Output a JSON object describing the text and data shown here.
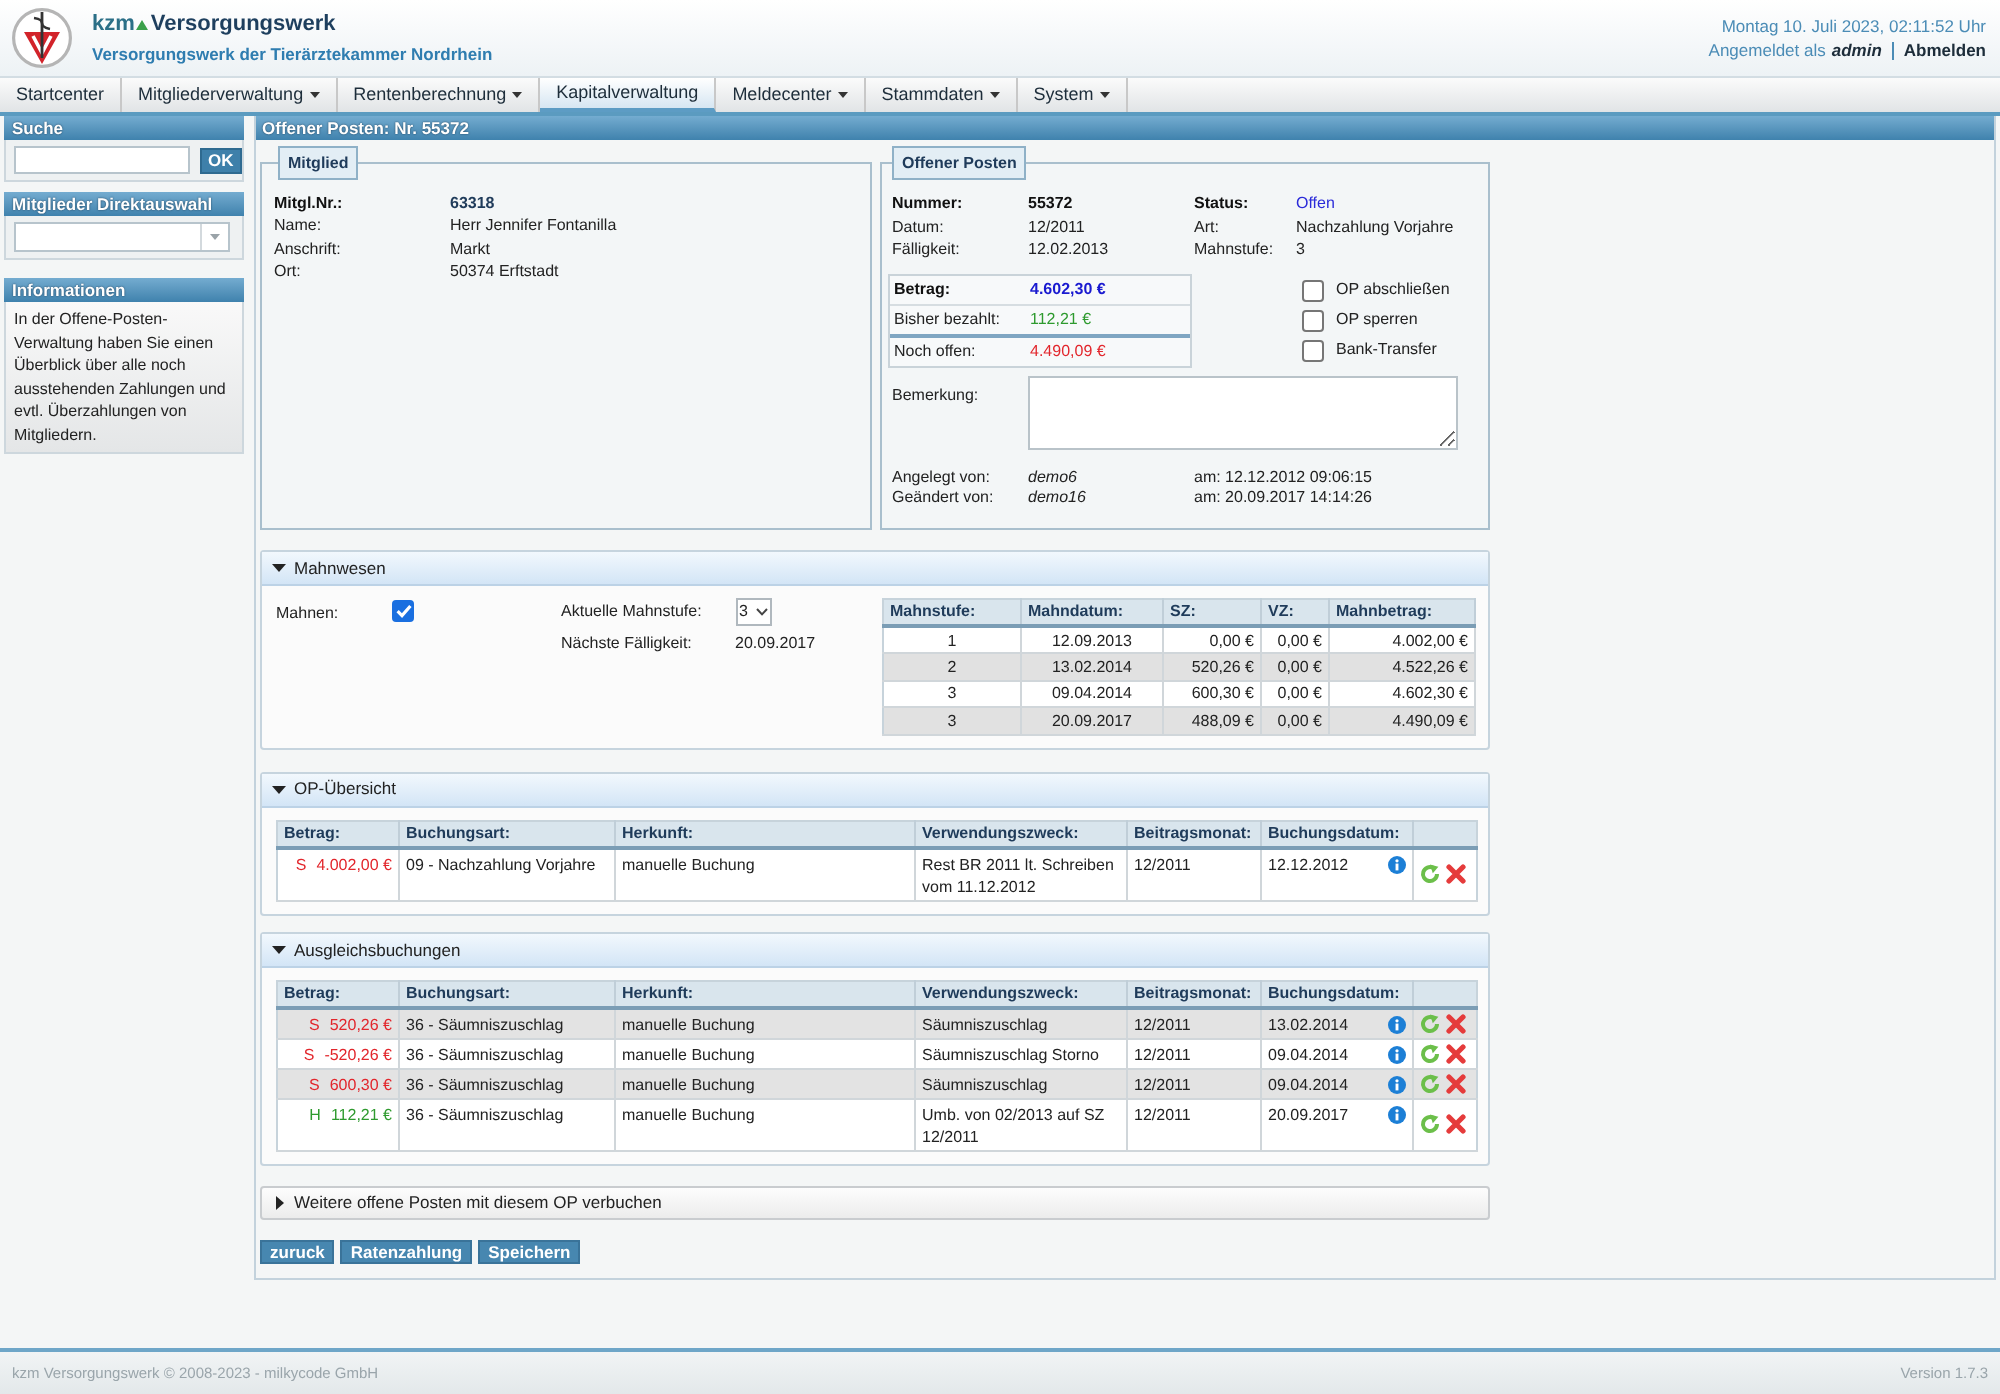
{
  "header": {
    "brand": "kzm",
    "title": "Versorgungswerk",
    "subtitle": "Versorgungswerk der Tierärztekammer Nordrhein",
    "datetime": "Montag 10. Juli 2023, 02:11:52 Uhr",
    "login_prefix": "Angemeldet als",
    "user": "admin",
    "logout": "Abmelden"
  },
  "nav": [
    {
      "label": "Startcenter",
      "has_menu": false,
      "selected": false
    },
    {
      "label": "Mitgliederverwaltung",
      "has_menu": true,
      "selected": false
    },
    {
      "label": "Rentenberechnung",
      "has_menu": true,
      "selected": false
    },
    {
      "label": "Kapitalverwaltung",
      "has_menu": false,
      "selected": true
    },
    {
      "label": "Meldecenter",
      "has_menu": true,
      "selected": false
    },
    {
      "label": "Stammdaten",
      "has_menu": true,
      "selected": false
    },
    {
      "label": "System",
      "has_menu": true,
      "selected": false
    }
  ],
  "sidebar": {
    "search": {
      "title": "Suche",
      "button": "OK"
    },
    "direct_select": {
      "title": "Mitglieder Direktauswahl"
    },
    "info": {
      "title": "Informationen",
      "text": "In der Offene-Posten-Verwaltung haben Sie einen Überblick über alle noch ausstehenden Zahlungen und evtl. Überzahlungen von Mitgliedern."
    }
  },
  "panel": {
    "title": "Offener Posten: Nr. 55372",
    "member": {
      "legend": "Mitglied",
      "fields": [
        {
          "label": "Mitgl.Nr.:",
          "value": "63318",
          "bold": true
        },
        {
          "label": "Name:",
          "value": "Herr Jennifer Fontanilla",
          "bold": false
        },
        {
          "label": "Anschrift:",
          "value": "Markt",
          "bold": false
        },
        {
          "label": "Ort:",
          "value": "50374 Erftstadt",
          "bold": false
        }
      ]
    },
    "open_item": {
      "legend": "Offener Posten",
      "left_fields": [
        {
          "label": "Nummer:",
          "value": "55372",
          "bold": true
        },
        {
          "label": "Datum:",
          "value": "12/2011",
          "bold": false
        },
        {
          "label": "Fälligkeit:",
          "value": "12.02.2013",
          "bold": false
        }
      ],
      "right_fields": [
        {
          "label": "Status:",
          "value": "Offen",
          "bold": true,
          "color": "#2b2bd9"
        },
        {
          "label": "Art:",
          "value": "Nachzahlung Vorjahre",
          "bold": false,
          "color": "#222222"
        },
        {
          "label": "Mahnstufe:",
          "value": "3",
          "bold": false,
          "color": "#222222"
        }
      ],
      "amounts": [
        {
          "label": "Betrag:",
          "value": "4.602,30 €",
          "bold": true,
          "color": "#1a1ad0"
        },
        {
          "label": "Bisher bezahlt:",
          "value": "112,21 €",
          "bold": false,
          "color": "#2e9a2e"
        },
        {
          "label": "Noch offen:",
          "value": "4.490,09 €",
          "bold": false,
          "color": "#e2262c"
        }
      ],
      "options": [
        {
          "label": "OP abschließen",
          "checked": false
        },
        {
          "label": "OP sperren",
          "checked": false
        },
        {
          "label": "Bank-Transfer",
          "checked": false
        }
      ],
      "remark_label": "Bemerkung:",
      "audit": [
        {
          "label": "Angelegt von:",
          "user": "demo6",
          "at": "am: 12.12.2012 09:06:15"
        },
        {
          "label": "Geändert von:",
          "user": "demo16",
          "at": "am: 20.09.2017 14:14:26"
        }
      ]
    },
    "dunning": {
      "title": "Mahnwesen",
      "expanded": true,
      "remind_label": "Mahnen:",
      "remind": true,
      "level_label": "Aktuelle Mahnstufe:",
      "level_value": "3",
      "next_label": "Nächste Fälligkeit:",
      "next_value": "20.09.2017",
      "table": {
        "columns": [
          "Mahnstufe:",
          "Mahndatum:",
          "SZ:",
          "VZ:",
          "Mahnbetrag:"
        ],
        "rows": [
          {
            "cells": [
              "1",
              "12.09.2013",
              "0,00 €",
              "0,00 €",
              "4.002,00 €"
            ],
            "shaded": false
          },
          {
            "cells": [
              "2",
              "13.02.2014",
              "520,26 €",
              "0,00 €",
              "4.522,26 €"
            ],
            "shaded": true
          },
          {
            "cells": [
              "3",
              "09.04.2014",
              "600,30 €",
              "0,00 €",
              "4.602,30 €"
            ],
            "shaded": false
          },
          {
            "cells": [
              "3",
              "20.09.2017",
              "488,09 €",
              "0,00 €",
              "4.490,09 €"
            ],
            "shaded": true
          }
        ]
      }
    },
    "op_overview": {
      "title": "OP-Übersicht",
      "expanded": true,
      "columns": [
        "Betrag:",
        "Buchungsart:",
        "Herkunft:",
        "Verwendungszweck:",
        "Beitragsmonat:",
        "Buchungsdatum:"
      ],
      "rows": [
        {
          "side": "S",
          "amount": "4.002,00 €",
          "color": "#e2262c",
          "booking_type": "09 - Nachzahlung Vorjahre",
          "origin": "manuelle Buchung",
          "purpose": "Rest BR 2011 lt. Schreiben vom 11.12.2012",
          "month": "12/2011",
          "date": "12.12.2012",
          "shaded": false
        }
      ]
    },
    "settlements": {
      "title": "Ausgleichsbuchungen",
      "expanded": true,
      "columns": [
        "Betrag:",
        "Buchungsart:",
        "Herkunft:",
        "Verwendungszweck:",
        "Beitragsmonat:",
        "Buchungsdatum:"
      ],
      "rows": [
        {
          "side": "S",
          "amount": "520,26 €",
          "color": "#e2262c",
          "booking_type": "36 - Säumniszuschlag",
          "origin": "manuelle Buchung",
          "purpose": "Säumniszuschlag",
          "month": "12/2011",
          "date": "13.02.2014",
          "shaded": true
        },
        {
          "side": "S",
          "amount": "-520,26 €",
          "color": "#e2262c",
          "booking_type": "36 - Säumniszuschlag",
          "origin": "manuelle Buchung",
          "purpose": "Säumniszuschlag Storno",
          "month": "12/2011",
          "date": "09.04.2014",
          "shaded": false
        },
        {
          "side": "S",
          "amount": "600,30 €",
          "color": "#e2262c",
          "booking_type": "36 - Säumniszuschlag",
          "origin": "manuelle Buchung",
          "purpose": "Säumniszuschlag",
          "month": "12/2011",
          "date": "09.04.2014",
          "shaded": true
        },
        {
          "side": "H",
          "amount": "112,21 €",
          "color": "#2e9a2e",
          "booking_type": "36 - Säumniszuschlag",
          "origin": "manuelle Buchung",
          "purpose": "Umb. von 02/2013 auf SZ 12/2011",
          "month": "12/2011",
          "date": "20.09.2017",
          "shaded": false
        }
      ]
    },
    "more_items": {
      "title": "Weitere offene Posten mit diesem OP verbuchen",
      "expanded": false
    },
    "buttons": [
      "zuruck",
      "Ratenzahlung",
      "Speichern"
    ]
  },
  "footer": {
    "copyright": "kzm Versorgungswerk © 2008-2023 - milkycode GmbH",
    "version": "Version 1.7.3"
  }
}
